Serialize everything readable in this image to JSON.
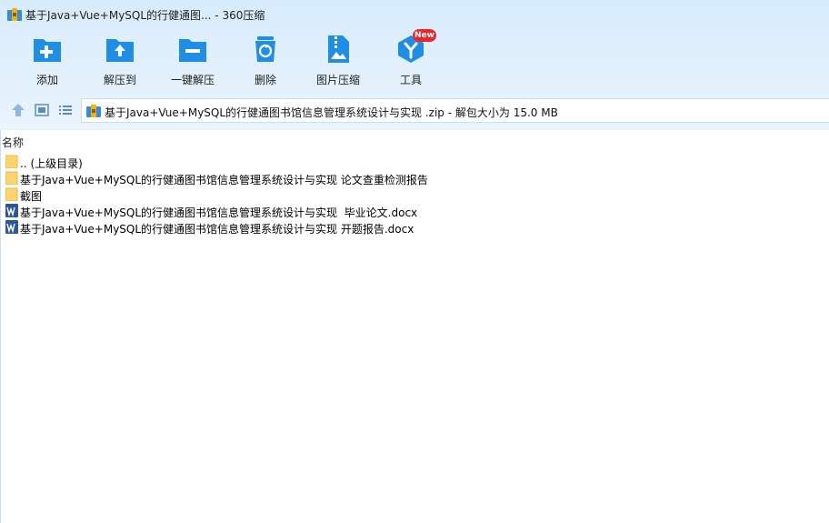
{
  "window": {
    "title": "基于Java+Vue+MySQL的行健通图...  - 360压缩"
  },
  "toolbar": {
    "items": [
      {
        "label": "添加",
        "icon": "add-icon"
      },
      {
        "label": "解压到",
        "icon": "extract-to-icon"
      },
      {
        "label": "一键解压",
        "icon": "one-click-extract-icon"
      },
      {
        "label": "删除",
        "icon": "delete-icon"
      },
      {
        "label": "图片压缩",
        "icon": "image-compress-icon"
      },
      {
        "label": "工具",
        "icon": "tools-icon"
      }
    ],
    "tools_badge": "New"
  },
  "address": {
    "text": "基于Java+Vue+MySQL的行健通图书馆信息管理系统设计与实现 .zip - 解包大小为 15.0 MB"
  },
  "list": {
    "column_name": "名称",
    "rows": [
      {
        "name": ".. (上级目录)",
        "type": "folder"
      },
      {
        "name": "基于Java+Vue+MySQL的行健通图书馆信息管理系统设计与实现 论文查重检测报告",
        "type": "folder"
      },
      {
        "name": "截图",
        "type": "folder"
      },
      {
        "name": "基于Java+Vue+MySQL的行健通图书馆信息管理系统设计与实现  毕业论文.docx",
        "type": "word"
      },
      {
        "name": "基于Java+Vue+MySQL的行健通图书馆信息管理系统设计与实现 开题报告.docx",
        "type": "word"
      }
    ]
  },
  "colors": {
    "accent_blue": "#1e8ee6",
    "folder_yellow": "#ffd56b",
    "word_blue": "#2b579a",
    "badge_red": "#e8262c"
  }
}
